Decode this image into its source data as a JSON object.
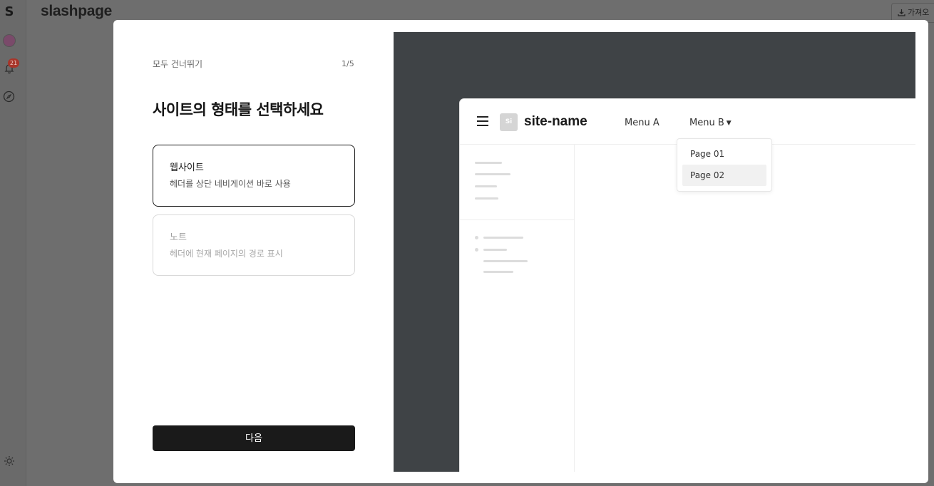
{
  "app": {
    "title": "slashpage",
    "import_label": "가져오",
    "notification_count": "21"
  },
  "onboarding": {
    "skip_label": "모두 건너뛰기",
    "step": "1/5",
    "heading": "사이트의 형태를 선택하세요",
    "options": [
      {
        "title": "웹사이트",
        "description": "헤더를 상단 네비게이션 바로 사용",
        "selected": true
      },
      {
        "title": "노트",
        "description": "헤더에 현재 페이지의 경로 표시",
        "selected": false
      }
    ],
    "next_label": "다음"
  },
  "preview": {
    "logo_text": "Si",
    "site_name": "site-name",
    "menu": [
      {
        "label": "Menu A"
      },
      {
        "label": "Menu B",
        "icon": "chevron-down-icon"
      }
    ],
    "dropdown": [
      "Page 01",
      "Page 02"
    ],
    "dropdown_active": "Page 02"
  },
  "colors": {
    "primary_button": "#1a1a1a",
    "preview_background": "#3f4346",
    "badge": "#a8352a"
  }
}
